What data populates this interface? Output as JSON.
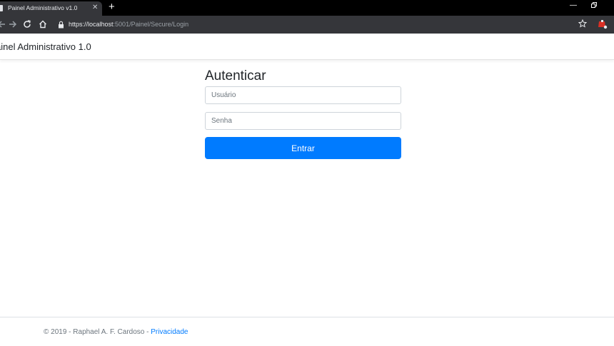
{
  "browser": {
    "tab_title": "Painel Administrativo v1.0",
    "tab_close": "✕",
    "new_tab": "+",
    "url_host": "https://localhost",
    "url_rest": ":5001/Painel/Secure/Login",
    "minimize": "—",
    "icons": [
      "back-arrow-icon",
      "forward-arrow-icon",
      "reload-icon",
      "home-icon",
      "lock-icon",
      "star-icon",
      "extension-icon"
    ]
  },
  "navbar": {
    "brand": "ainel Administrativo 1.0"
  },
  "login": {
    "title": "Autenticar",
    "username_placeholder": "Usuário",
    "password_placeholder": "Senha",
    "submit_label": "Entrar"
  },
  "footer": {
    "text": "© 2019 - Raphael A. F. Cardoso - ",
    "link": "Privacidade"
  },
  "colors": {
    "primary": "#007bff",
    "chrome_dark": "#35363a",
    "tabstrip": "#000000"
  }
}
